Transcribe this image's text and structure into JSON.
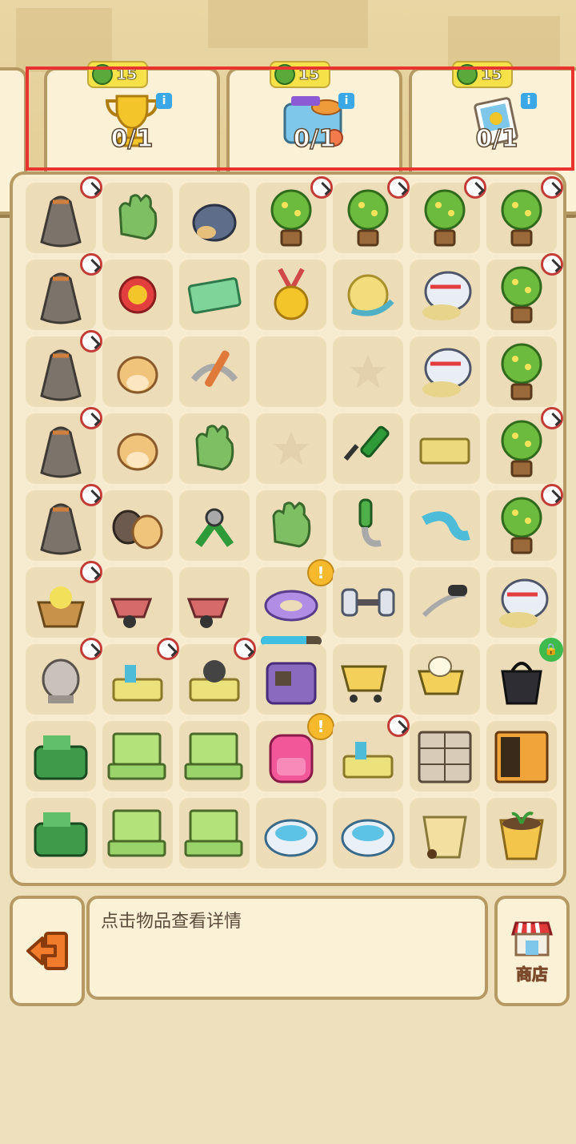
{
  "quests": [
    {
      "id": "partial",
      "reward": "",
      "progress": ""
    },
    {
      "id": "trophy-quest",
      "reward": "15",
      "progress": "0/1"
    },
    {
      "id": "gym-quest",
      "reward": "15",
      "progress": "0/1"
    },
    {
      "id": "photo-quest",
      "reward": "15",
      "progress": "0/1"
    }
  ],
  "hint_text": "点击物品查看详情",
  "shop_label": "商店",
  "grid_items": [
    "money-bag",
    "green-glove",
    "stone-hedgehog",
    "flower-tree",
    "flower-tree",
    "flower-tree",
    "flower-tree",
    "money-bag",
    "medal-badge",
    "cash-bill",
    "gold-medal",
    "yarn-ball",
    "treadmill-snail",
    "flower-tree",
    "money-bag",
    "hamster",
    "pickaxe",
    "empty",
    "empty-star",
    "treadmill-snail",
    "flower-tree",
    "money-bag",
    "hamster",
    "green-glove",
    "empty-star",
    "screwdriver",
    "tray",
    "flower-tree",
    "money-bag",
    "hamster-pair",
    "pliers",
    "green-glove",
    "pipe",
    "blue-ribbon",
    "flower-tree",
    "flower-basket",
    "wheelbarrow",
    "wheelbarrow",
    "donut-pool",
    "dumbbell",
    "resistance-band",
    "treadmill-snail",
    "hamster-statue",
    "basket-tools",
    "basket-gear",
    "bag-pile",
    "shopping-cart",
    "cart-duck",
    "black-bag",
    "green-kit",
    "laptop",
    "laptop",
    "pink-backpack",
    "basket-tools",
    "locker",
    "cabinet",
    "green-kit",
    "laptop",
    "laptop",
    "robot-vacuum",
    "robot-vacuum",
    "bucket",
    "plant-pot"
  ],
  "badges_clock": [
    0,
    3,
    4,
    5,
    6,
    7,
    13,
    14,
    21,
    27,
    28,
    34,
    35,
    42,
    43,
    44,
    53
  ],
  "badge_alert": [
    38,
    52
  ],
  "badge_lock": [
    48
  ],
  "progress_cell": 38,
  "progress_fraction": 0.75,
  "colors": {
    "accent": "#e8332f",
    "panel_border": "#b69a63"
  }
}
